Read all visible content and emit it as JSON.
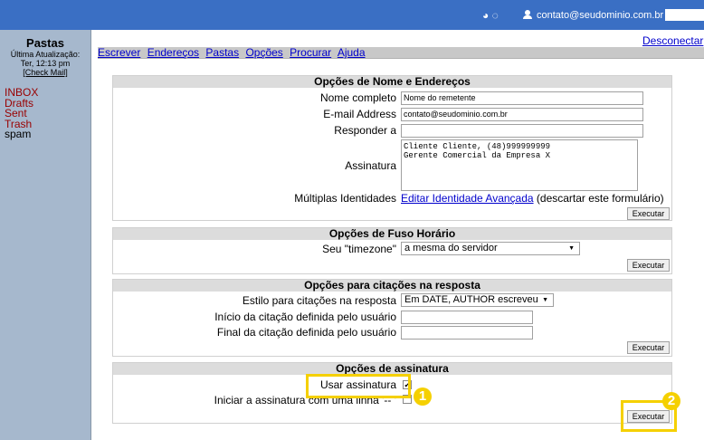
{
  "topbar": {
    "icons_text": "◕ ◌",
    "user_email": "contato@seudominio.com.br ▾"
  },
  "sidebar": {
    "title": "Pastas",
    "last_update_label": "Última Atualização:",
    "last_update_time": "Ter, 12:13 pm",
    "check_mail": "[Check Mail]",
    "folders": [
      "INBOX",
      "Drafts",
      "Sent",
      "Trash",
      "spam"
    ]
  },
  "disconnect": "Desconectar",
  "nav": [
    "Escrever",
    "Endereços",
    "Pastas",
    "Opções",
    "Procurar",
    "Ajuda"
  ],
  "names_panel": {
    "title": "Opções de Nome e Endereços",
    "full_name_label": "Nome completo",
    "full_name_value": "Nome do remetente",
    "email_label": "E-mail Address",
    "email_value": "contato@seudominio.com.br",
    "reply_label": "Responder a",
    "reply_value": "",
    "signature_label": "Assinatura",
    "signature_line1": "Cliente Cliente, (48)999999999",
    "signature_line2": "Gerente Comercial da Empresa X",
    "multi_label": "Múltiplas Identidades",
    "multi_link": "Editar Identidade Avançada",
    "multi_note": "(descartar este formulário)",
    "button": "Executar"
  },
  "tz_panel": {
    "title": "Opções de Fuso Horário",
    "tz_label": "Seu \"timezone\"",
    "tz_value": "a mesma do servidor",
    "button": "Executar"
  },
  "quote_panel": {
    "title": "Opções para citações na resposta",
    "style_label": "Estilo para citações na resposta",
    "style_value": "Em DATE, AUTHOR escreveu",
    "start_label": "Início da citação definida pelo usuário",
    "end_label": "Final da citação definida pelo usuário",
    "button": "Executar"
  },
  "sig_panel": {
    "title": "Opções de assinatura",
    "use_label": "Usar assinatura",
    "use_checked": "✔",
    "dashes_label": "Iniciar a assinatura com uma linha '-- '",
    "button": "Executar"
  },
  "badges": [
    "1",
    "2"
  ],
  "accent": "#f5d000",
  "topbar_color": "#3a6fc4",
  "sidebar_color": "#a6b8cd"
}
